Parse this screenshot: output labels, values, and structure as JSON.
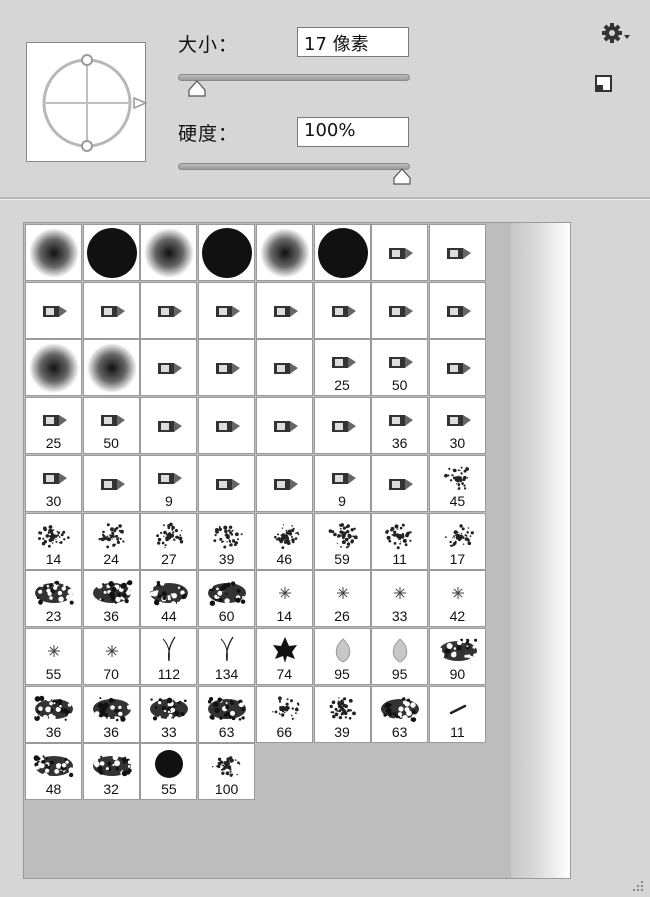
{
  "brush_options": {
    "size_label": "大小：",
    "size_value": "17 像素",
    "size_slider_fraction": 0.05,
    "hardness_label": "硬度：",
    "hardness_value": "100%",
    "hardness_slider_fraction": 1.0
  },
  "toolbar": {
    "settings_icon": "gear-icon",
    "new_preset_icon": "new-preset-icon"
  },
  "presets": [
    {
      "kind": "soft",
      "size": ""
    },
    {
      "kind": "hard",
      "size": ""
    },
    {
      "kind": "soft",
      "size": ""
    },
    {
      "kind": "hard",
      "size": ""
    },
    {
      "kind": "soft",
      "size": ""
    },
    {
      "kind": "hard",
      "size": ""
    },
    {
      "kind": "tip",
      "size": ""
    },
    {
      "kind": "tip",
      "size": ""
    },
    {
      "kind": "tip",
      "size": ""
    },
    {
      "kind": "tip",
      "size": ""
    },
    {
      "kind": "tip",
      "size": ""
    },
    {
      "kind": "tip",
      "size": ""
    },
    {
      "kind": "tip",
      "size": ""
    },
    {
      "kind": "tip",
      "size": ""
    },
    {
      "kind": "tip",
      "size": ""
    },
    {
      "kind": "tip",
      "size": ""
    },
    {
      "kind": "soft",
      "size": ""
    },
    {
      "kind": "soft",
      "size": ""
    },
    {
      "kind": "tip",
      "size": ""
    },
    {
      "kind": "tip",
      "size": ""
    },
    {
      "kind": "tip",
      "size": ""
    },
    {
      "kind": "tip",
      "size": "25"
    },
    {
      "kind": "tip",
      "size": "50"
    },
    {
      "kind": "tip",
      "size": ""
    },
    {
      "kind": "tip",
      "size": "25"
    },
    {
      "kind": "tip",
      "size": "50"
    },
    {
      "kind": "tip",
      "size": ""
    },
    {
      "kind": "tip",
      "size": ""
    },
    {
      "kind": "tip",
      "size": ""
    },
    {
      "kind": "tip",
      "size": ""
    },
    {
      "kind": "tip",
      "size": "36"
    },
    {
      "kind": "tip",
      "size": "30"
    },
    {
      "kind": "tip",
      "size": "30"
    },
    {
      "kind": "tip",
      "size": ""
    },
    {
      "kind": "tip",
      "size": "9"
    },
    {
      "kind": "tip",
      "size": ""
    },
    {
      "kind": "tip",
      "size": ""
    },
    {
      "kind": "tip",
      "size": "9"
    },
    {
      "kind": "tip",
      "size": ""
    },
    {
      "kind": "scatter",
      "size": "45"
    },
    {
      "kind": "scatter",
      "size": "14"
    },
    {
      "kind": "scatter",
      "size": "24"
    },
    {
      "kind": "scatter",
      "size": "27"
    },
    {
      "kind": "scatter",
      "size": "39"
    },
    {
      "kind": "scatter",
      "size": "46"
    },
    {
      "kind": "scatter",
      "size": "59"
    },
    {
      "kind": "scatter",
      "size": "11"
    },
    {
      "kind": "scatter",
      "size": "17"
    },
    {
      "kind": "texture",
      "size": "23"
    },
    {
      "kind": "texture",
      "size": "36"
    },
    {
      "kind": "texture",
      "size": "44"
    },
    {
      "kind": "texture",
      "size": "60"
    },
    {
      "kind": "star",
      "size": "14"
    },
    {
      "kind": "star",
      "size": "26"
    },
    {
      "kind": "star",
      "size": "33"
    },
    {
      "kind": "star",
      "size": "42"
    },
    {
      "kind": "star",
      "size": "55"
    },
    {
      "kind": "star",
      "size": "70"
    },
    {
      "kind": "grass",
      "size": "112"
    },
    {
      "kind": "grass",
      "size": "134"
    },
    {
      "kind": "leaf",
      "size": "74"
    },
    {
      "kind": "leafsoft",
      "size": "95"
    },
    {
      "kind": "leafsoft",
      "size": "95"
    },
    {
      "kind": "texture",
      "size": "90"
    },
    {
      "kind": "texture",
      "size": "36"
    },
    {
      "kind": "texture",
      "size": "36"
    },
    {
      "kind": "texture",
      "size": "33"
    },
    {
      "kind": "texture",
      "size": "63"
    },
    {
      "kind": "scatter",
      "size": "66"
    },
    {
      "kind": "scatter",
      "size": "39"
    },
    {
      "kind": "texture",
      "size": "63"
    },
    {
      "kind": "dash",
      "size": "11"
    },
    {
      "kind": "texture",
      "size": "48"
    },
    {
      "kind": "texture",
      "size": "32"
    },
    {
      "kind": "hardsmall",
      "size": "55"
    },
    {
      "kind": "scatter",
      "size": "100"
    }
  ]
}
